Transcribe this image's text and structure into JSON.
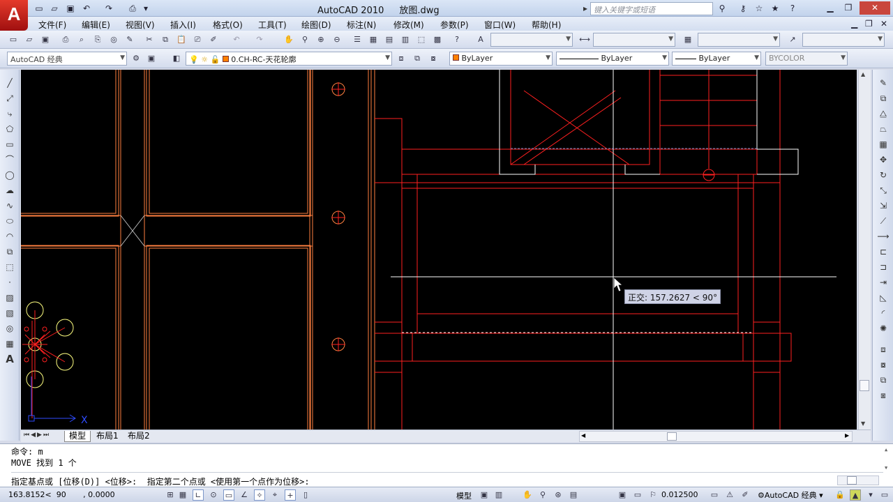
{
  "app": {
    "logo": "A",
    "title": "AutoCAD 2010",
    "filename": "放图.dwg"
  },
  "search": {
    "placeholder": "键入关键字或短语"
  },
  "menus": [
    "文件(F)",
    "编辑(E)",
    "视图(V)",
    "插入(I)",
    "格式(O)",
    "工具(T)",
    "绘图(D)",
    "标注(N)",
    "修改(M)",
    "参数(P)",
    "窗口(W)",
    "帮助(H)"
  ],
  "workspace": {
    "value": "AutoCAD 经典"
  },
  "layer": {
    "value": "0.CH-RC-天花轮廓",
    "color": "#ff8000"
  },
  "properties": {
    "color": "ByLayer",
    "linetype": "ByLayer",
    "lineweight": "ByLayer",
    "plotstyle": "BYCOLOR"
  },
  "tooltip": {
    "text": "正交: 157.2627 < 90°"
  },
  "layout_tabs": [
    "模型",
    "布局1",
    "布局2"
  ],
  "command": {
    "line1": "命令: m",
    "line2": "MOVE 找到 1 个",
    "prompt": "指定基点或 [位移(D)] <位移>:  指定第二个点或 <使用第一个点作为位移>:"
  },
  "status": {
    "coords": "163.8152<  90       , 0.0000",
    "model_label": "模型",
    "scale": "0.012500",
    "workspace": "AutoCAD 经典"
  },
  "ucs": {
    "x_label": "X"
  },
  "colors": {
    "canvas": "#000000",
    "red": "#ff0000",
    "orange": "#ff8040",
    "white": "#ffffff"
  }
}
